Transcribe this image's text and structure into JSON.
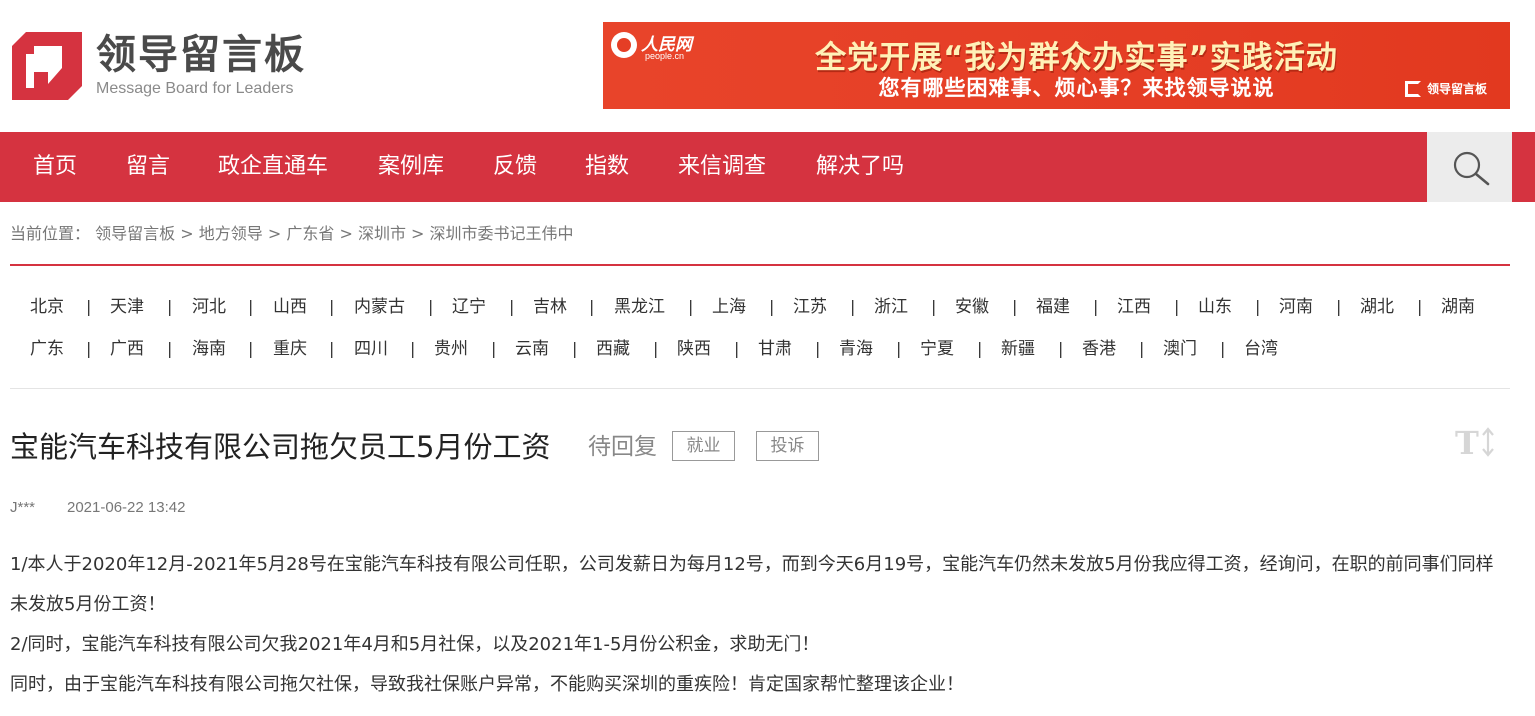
{
  "logo": {
    "cn": "领导留言板",
    "en": "Message Board for Leaders"
  },
  "banner": {
    "brand_name": "人民网",
    "brand_sub": "people.cn",
    "line1": "全党开展“我为群众办实事”实践活动",
    "line2": "您有哪些困难事、烦心事？来找领导说说",
    "mini_logo": "领导留言板"
  },
  "nav": {
    "items": [
      "首页",
      "留言",
      "政企直通车",
      "案例库",
      "反馈",
      "指数",
      "来信调查",
      "解决了吗"
    ]
  },
  "breadcrumb": {
    "prefix": "当前位置：",
    "items": [
      "领导留言板",
      "地方领导",
      "广东省",
      "深圳市",
      "深圳市委书记王伟中"
    ],
    "separator": ">"
  },
  "regions": {
    "row1": [
      "北京",
      "天津",
      "河北",
      "山西",
      "内蒙古",
      "辽宁",
      "吉林",
      "黑龙江",
      "上海",
      "江苏",
      "浙江",
      "安徽",
      "福建",
      "江西",
      "山东",
      "河南",
      "湖北",
      "湖南"
    ],
    "row2": [
      "广东",
      "广西",
      "海南",
      "重庆",
      "四川",
      "贵州",
      "云南",
      "西藏",
      "陕西",
      "甘肃",
      "青海",
      "宁夏",
      "新疆",
      "香港",
      "澳门",
      "台湾"
    ],
    "separator": "|"
  },
  "message": {
    "title": "宝能汽车科技有限公司拖欠员工5月份工资",
    "status": "待回复",
    "tags": [
      "就业",
      "投诉"
    ],
    "author": "J***",
    "time": "2021-06-22 13:42",
    "paragraphs": [
      "1/本人于2020年12月-2021年5月28号在宝能汽车科技有限公司任职，公司发薪日为每月12号，而到今天6月19号，宝能汽车仍然未发放5月份我应得工资，经询问，在职的前同事们同样未发放5月份工资！",
      "2/同时，宝能汽车科技有限公司欠我2021年4月和5月社保，以及2021年1-5月份公积金，求助无门！",
      "同时，由于宝能汽车科技有限公司拖欠社保，导致我社保账户异常，不能购买深圳的重疾险！肯定国家帮忙整理该企业！"
    ]
  },
  "colors": {
    "brand_red": "#d53340",
    "banner_red": "#e53e25"
  },
  "icons": {
    "search": "search-icon",
    "font_size": "font-size-icon"
  }
}
